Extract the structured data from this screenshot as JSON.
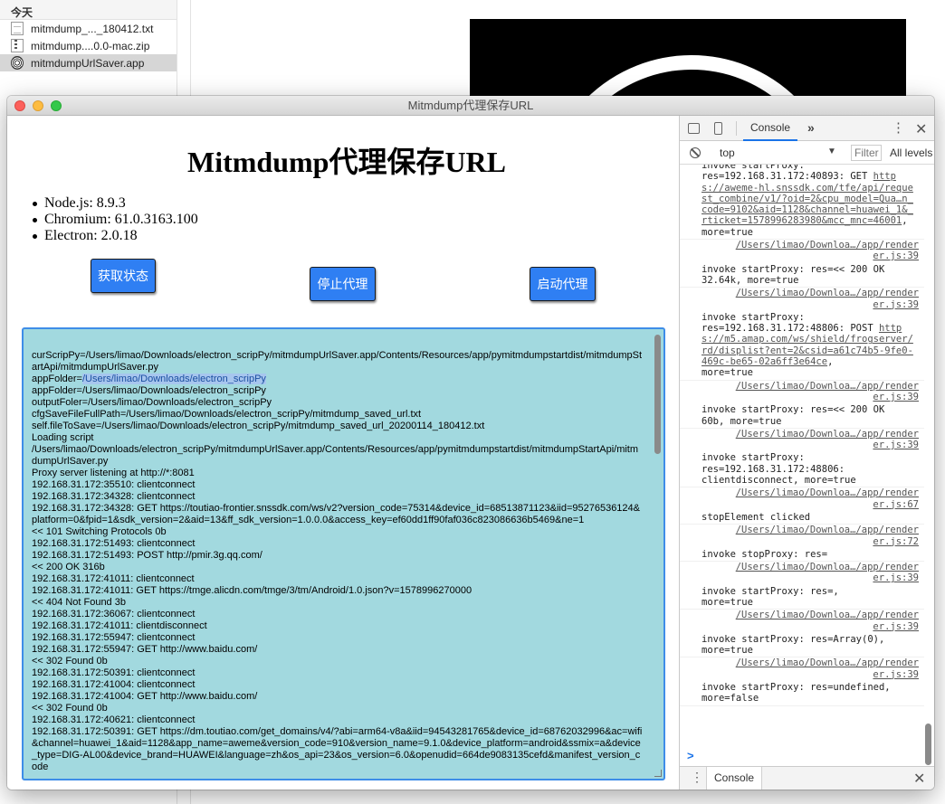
{
  "finder": {
    "section_header": "今天",
    "items": [
      {
        "name": "mitmdump_..._180412.txt",
        "icon": "text-file-icon"
      },
      {
        "name": "mitmdump....0.0-mac.zip",
        "icon": "zip-file-icon"
      },
      {
        "name": "mitmdumpUrlSaver.app",
        "icon": "app-icon"
      }
    ]
  },
  "window": {
    "title": "Mitmdump代理保存URL"
  },
  "app": {
    "heading": "Mitmdump代理保存URL",
    "versions": [
      "Node.js: 8.9.3",
      "Chromium: 61.0.3163.100",
      "Electron: 2.0.18"
    ],
    "buttons": {
      "status": "获取状态",
      "stop": "停止代理",
      "start": "启动代理"
    },
    "log": {
      "before_selection": "curScripPy=/Users/limao/Downloads/electron_scripPy/mitmdumpUrlSaver.app/Contents/Resources/app/pymitmdumpstartdist/mitmdumpStartApi/mitmdumpUrlSaver.py\nappFolder=",
      "selection": "/Users/limao/Downloads/electron_scripPy",
      "after_selection": "\nappFolder=/Users/limao/Downloads/electron_scripPy\noutputFoler=/Users/limao/Downloads/electron_scripPy\ncfgSaveFileFullPath=/Users/limao/Downloads/electron_scripPy/mitmdump_saved_url.txt\nself.fileToSave=/Users/limao/Downloads/electron_scripPy/mitmdump_saved_url_20200114_180412.txt\nLoading script\n/Users/limao/Downloads/electron_scripPy/mitmdumpUrlSaver.app/Contents/Resources/app/pymitmdumpstartdist/mitmdumpStartApi/mitmdumpUrlSaver.py\nProxy server listening at http://*:8081\n192.168.31.172:35510: clientconnect\n192.168.31.172:34328: clientconnect\n192.168.31.172:34328: GET https://toutiao-frontier.snssdk.com/ws/v2?version_code=75314&device_id=68513871123&iid=95276536124&platform=0&fpid=1&sdk_version=2&aid=13&ff_sdk_version=1.0.0.0&access_key=ef60dd1ff90faf036c823086636b5469&ne=1\n<< 101 Switching Protocols 0b\n192.168.31.172:51493: clientconnect\n192.168.31.172:51493: POST http://pmir.3g.qq.com/\n<< 200 OK 316b\n192.168.31.172:41011: clientconnect\n192.168.31.172:41011: GET https://tmge.alicdn.com/tmge/3/tm/Android/1.0.json?v=1578996270000\n<< 404 Not Found 3b\n192.168.31.172:36067: clientconnect\n192.168.31.172:41011: clientdisconnect\n192.168.31.172:55947: clientconnect\n192.168.31.172:55947: GET http://www.baidu.com/\n<< 302 Found 0b\n192.168.31.172:50391: clientconnect\n192.168.31.172:41004: clientconnect\n192.168.31.172:41004: GET http://www.baidu.com/\n<< 302 Found 0b\n192.168.31.172:40621: clientconnect\n192.168.31.172:50391: GET https://dm.toutiao.com/get_domains/v4/?abi=arm64-v8a&iid=94543281765&device_id=68762032996&ac=wifi&channel=huawei_1&aid=1128&app_name=aweme&version_code=910&version_name=9.1.0&device_platform=android&ssmix=a&device_type=DIG-AL00&device_brand=HUAWEI&language=zh&os_api=23&os_version=6.0&openudid=664de9083135cefd&manifest_version_code"
    }
  },
  "devtools": {
    "tab_console": "Console",
    "more": "»",
    "context": "top",
    "filter_placeholder": "Filter",
    "levels": "All levels",
    "drawer_tab": "Console",
    "prompt": ">",
    "messages": [
      {
        "text": "invoke startProxy:\nres=192.168.31.172:40893: GET ",
        "link": "https://aweme-hl.snssdk.com/tfe/api/request_combine/v1/?oid=2&cpu_model=Qua…n_code=9102&aid=1128&channel=huawei_1&_rticket=1578996283980&mcc_mnc=46001",
        "tail": ", more=true",
        "src": "/Users/limao/Downloa…/app/render\ner.js:39"
      },
      {
        "text": "invoke startProxy: res=<< 200 OK\n32.64k, more=true",
        "link": "",
        "tail": "",
        "src": "/Users/limao/Downloa…/app/render\ner.js:39"
      },
      {
        "text": "invoke startProxy:\nres=192.168.31.172:48806: POST ",
        "link": "https://m5.amap.com/ws/shield/frogserver/rd/displist?ent=2&csid=a61c74b5-9fe0-469c-be65-02a6ff3e64ce",
        "tail": ",\nmore=true",
        "src": "/Users/limao/Downloa…/app/render\ner.js:39"
      },
      {
        "text": "invoke startProxy: res=<< 200 OK\n60b, more=true",
        "link": "",
        "tail": "",
        "src": "/Users/limao/Downloa…/app/render\ner.js:39"
      },
      {
        "text": "invoke startProxy:\nres=192.168.31.172:48806:\nclientdisconnect, more=true",
        "link": "",
        "tail": "",
        "src": "/Users/limao/Downloa…/app/render\ner.js:67"
      },
      {
        "text": "stopElement clicked",
        "link": "",
        "tail": "",
        "src": "/Users/limao/Downloa…/app/render\ner.js:72"
      },
      {
        "text": "invoke stopProxy: res=",
        "link": "",
        "tail": "",
        "src": "/Users/limao/Downloa…/app/render\ner.js:39"
      },
      {
        "text": "invoke startProxy: res=,\nmore=true",
        "link": "",
        "tail": "",
        "src": "/Users/limao/Downloa…/app/render\ner.js:39"
      },
      {
        "text": "invoke startProxy: res=Array(0),\nmore=true",
        "link": "",
        "tail": "",
        "src": "/Users/limao/Downloa…/app/render\ner.js:39"
      },
      {
        "text": "invoke startProxy: res=undefined,\nmore=false",
        "link": "",
        "tail": "",
        "src": ""
      }
    ]
  }
}
